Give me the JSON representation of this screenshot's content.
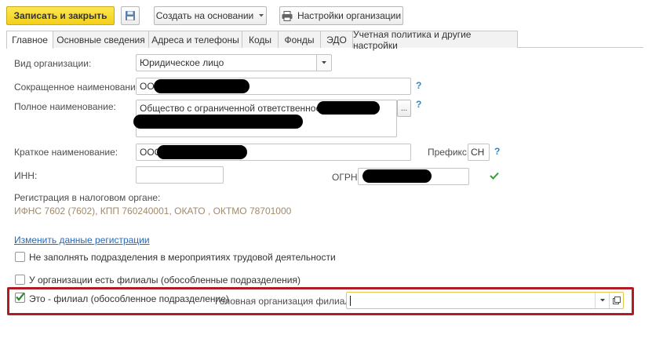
{
  "toolbar": {
    "save_close_label": "Записать и закрыть",
    "create_based_label": "Создать на основании",
    "org_settings_label": "Настройки организации"
  },
  "tabs": [
    {
      "label": "Главное"
    },
    {
      "label": "Основные сведения"
    },
    {
      "label": "Адреса и телефоны"
    },
    {
      "label": "Коды"
    },
    {
      "label": "Фонды"
    },
    {
      "label": "ЭДО"
    },
    {
      "label": "Учетная политика и другие настройки"
    }
  ],
  "form": {
    "org_type_label": "Вид организации:",
    "org_type_value": "Юридическое лицо",
    "short_name_label": "Сокращенное наименование:",
    "short_name_value": "ООО",
    "full_name_label": "Полное наименование:",
    "full_name_value": "Общество с ограниченной ответственностью",
    "brief_name_label": "Краткое наименование:",
    "brief_name_value": "ООО",
    "prefix_label": "Префикс:",
    "prefix_value": "СН",
    "inn_label": "ИНН:",
    "inn_value": "",
    "ogrn_label": "ОГРН:",
    "ogrn_value": "",
    "help_mark": "?",
    "ellipsis": "...",
    "registration_label": "Регистрация в налоговом органе:",
    "registration_value": "ИФНС 7602 (7602), КПП 760240001, ОКАТО , ОКТМО 78701000",
    "change_registration_link": "Изменить данные регистрации",
    "no_fill_subdivisions_label": "Не заполнять подразделения в мероприятиях трудовой деятельности",
    "has_branches_label": "У организации есть филиалы (обособленные подразделения)",
    "is_branch_label": "Это - филиал (обособленное подразделение)",
    "parent_org_label": "Головная организация филиала:",
    "parent_org_value": ""
  },
  "colors": {
    "highlight_border": "#b01c22",
    "primary_button": "#f3cf1c",
    "link": "#2a68b5",
    "help": "#2a88c7",
    "registration_text": "#a08a6a",
    "valid_check": "#3c9a3c"
  },
  "icons": [
    "save-disk-icon",
    "dropdown-arrow-icon",
    "printer-icon",
    "question-icon",
    "checkmark-icon",
    "open-form-icon"
  ]
}
